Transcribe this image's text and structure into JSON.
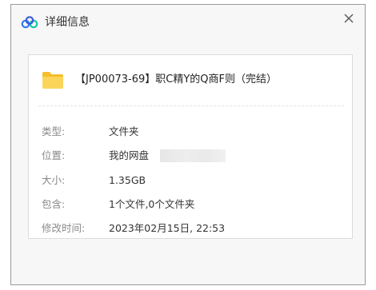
{
  "window": {
    "title": "详细信息",
    "app_icon": "cloud-drive-icon",
    "close_icon": "close-icon"
  },
  "file": {
    "icon": "folder-icon",
    "name": "【JP00073-69】职C精Y的Q商F则（完结）"
  },
  "details": [
    {
      "label": "类型:",
      "value": "文件夹"
    },
    {
      "label": "位置:",
      "value": "我的网盘"
    },
    {
      "label": "大小:",
      "value": "1.35GB"
    },
    {
      "label": "包含:",
      "value": "1个文件,0个文件夹"
    },
    {
      "label": "修改时间:",
      "value": "2023年02月15日, 22:53"
    }
  ],
  "colors": {
    "brand_blue": "#3a7bd5",
    "folder_yellow": "#f8c53a"
  }
}
